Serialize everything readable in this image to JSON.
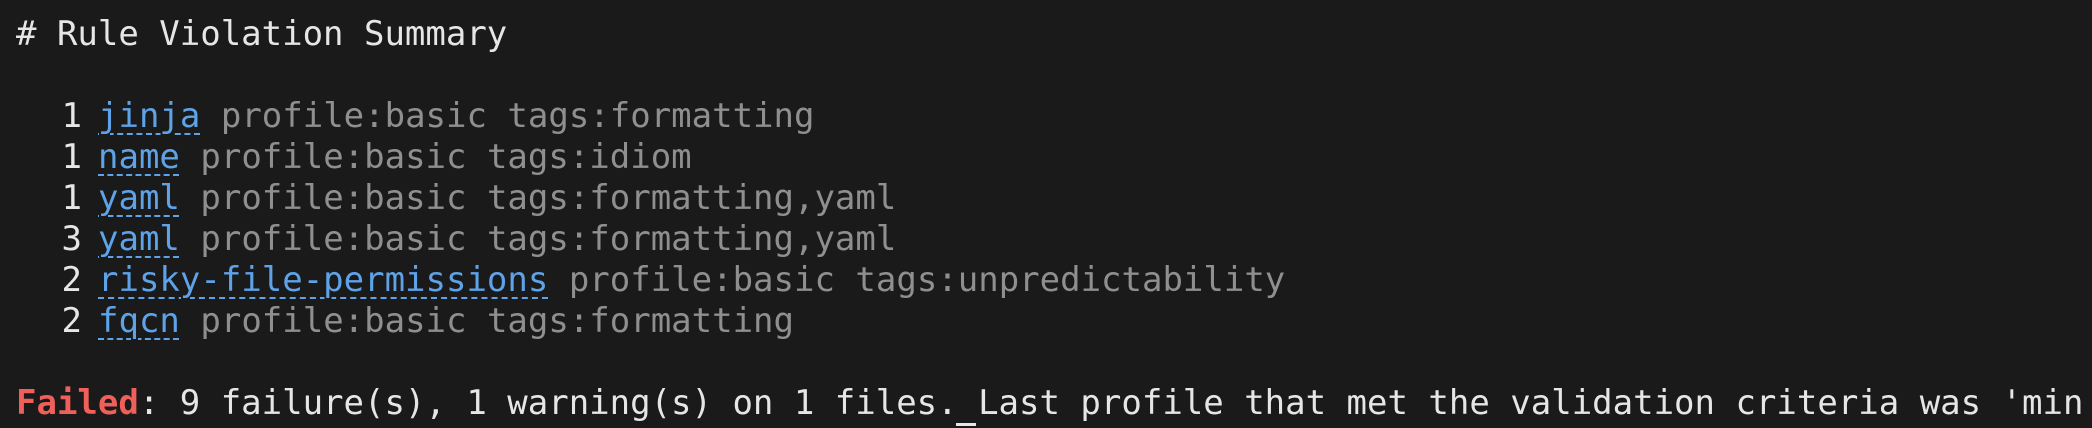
{
  "header": {
    "title": "# Rule Violation Summary"
  },
  "rows": [
    {
      "count": "1",
      "rule": "jinja",
      "meta": "profile:basic tags:formatting"
    },
    {
      "count": "1",
      "rule": "name",
      "meta": "profile:basic tags:idiom"
    },
    {
      "count": "1",
      "rule": "yaml",
      "meta": "profile:basic tags:formatting,yaml"
    },
    {
      "count": "3",
      "rule": "yaml",
      "meta": "profile:basic tags:formatting,yaml"
    },
    {
      "count": "2",
      "rule": "risky-file-permissions",
      "meta": "profile:basic tags:unpredictability"
    },
    {
      "count": "2",
      "rule": "fqcn",
      "meta": "profile:basic tags:formatting"
    }
  ],
  "status": {
    "failed_label": "Failed",
    "message": ": 9 failure(s), 1 warning(s) on 1 files. Last profile that met the validation criteria was 'min'."
  },
  "colors": {
    "background": "#1a1a1a",
    "text": "#e6e6e6",
    "link": "#5ea2e8",
    "meta": "#8f8f8f",
    "failed": "#f0605a"
  }
}
